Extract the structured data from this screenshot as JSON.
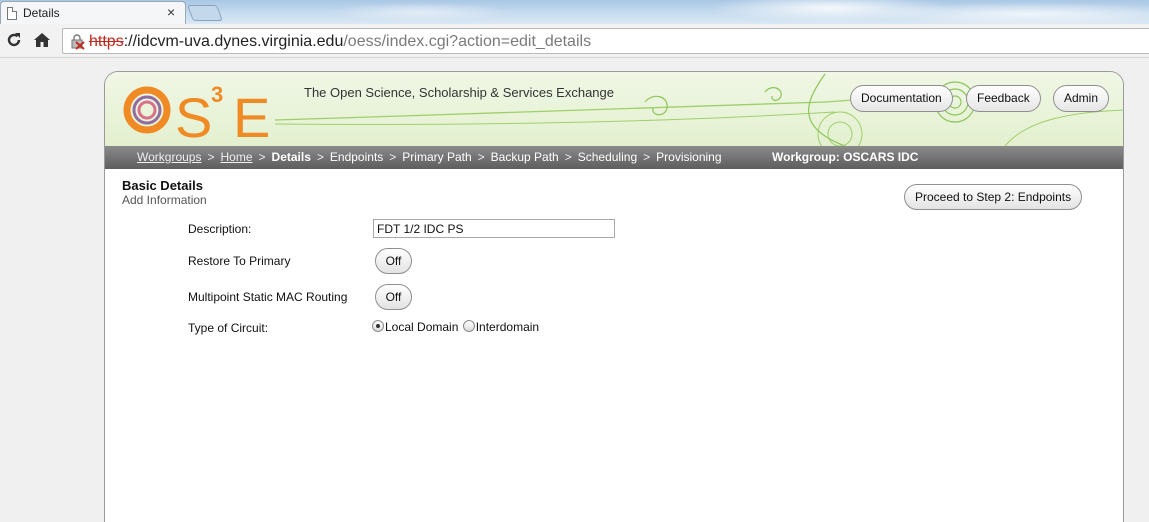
{
  "browser": {
    "tab_title": "Details",
    "tab_close": "×",
    "url_scheme": "https",
    "url_host": "://idcvm-uva.dynes.virginia.edu",
    "url_path": "/oess/index.cgi?action=edit_details"
  },
  "header": {
    "logo_text": "OS³E",
    "tagline": "The Open Science, Scholarship & Services Exchange",
    "buttons": {
      "documentation": "Documentation",
      "feedback": "Feedback",
      "admin": "Admin"
    }
  },
  "breadcrumb": {
    "items": [
      "Workgroups",
      "Home",
      "Details",
      "Endpoints",
      "Primary Path",
      "Backup Path",
      "Scheduling",
      "Provisioning"
    ],
    "separator": ">",
    "workgroup": "Workgroup: OSCARS IDC"
  },
  "section": {
    "title": "Basic Details",
    "subtitle": "Add Information",
    "proceed_button": "Proceed to Step 2: Endpoints"
  },
  "form": {
    "description_label": "Description:",
    "description_value": "FDT 1/2 IDC PS",
    "restore_label": "Restore To Primary",
    "restore_value": "Off",
    "multipoint_label": "Multipoint Static MAC Routing",
    "multipoint_value": "Off",
    "circuit_type_label": "Type of Circuit:",
    "circuit_options": [
      "Local Domain",
      "Interdomain"
    ],
    "circuit_selected": "Local Domain"
  },
  "colors": {
    "accent_orange": "#f08a24",
    "header_green": "#e3f0cf",
    "crumb_gray": "#6a6a6a"
  }
}
